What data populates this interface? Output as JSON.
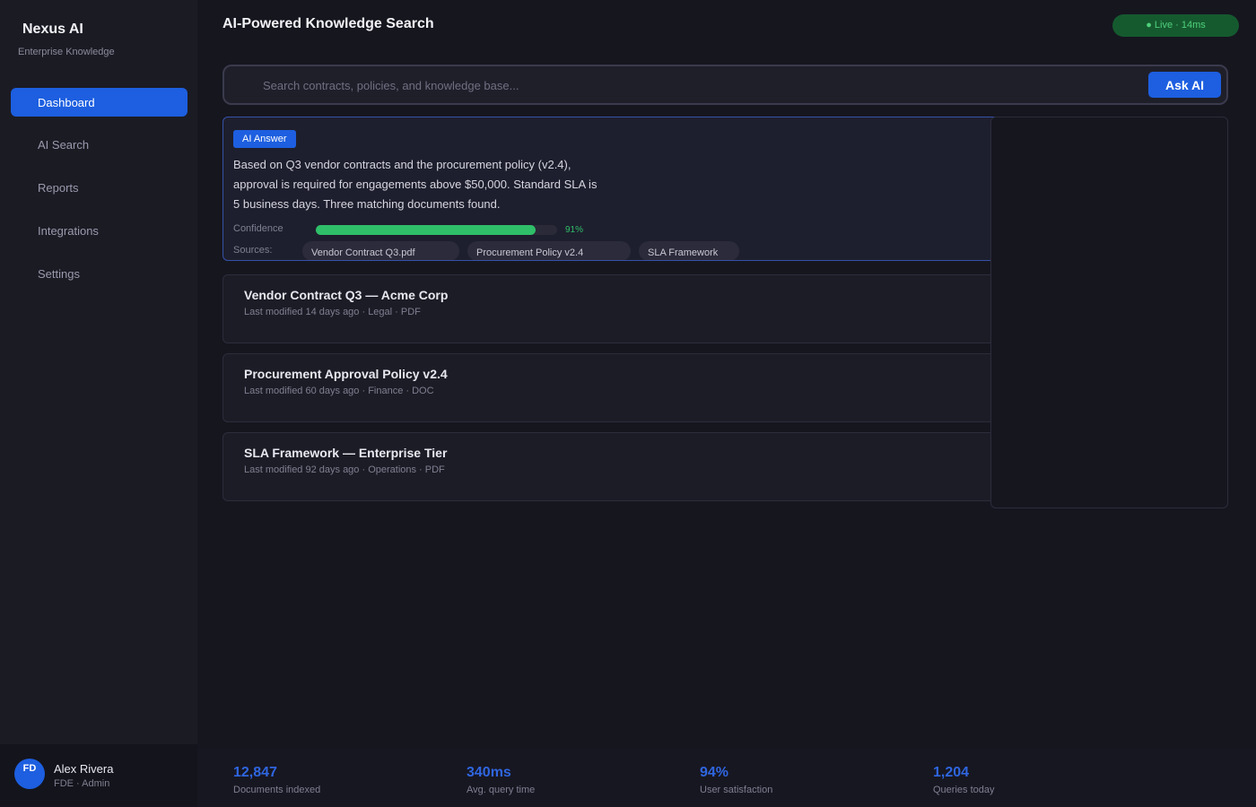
{
  "brand": {
    "icon": "brain-icon",
    "glyph": "",
    "name": "Nexus AI",
    "subtitle": "Enterprise Knowledge"
  },
  "sidebar": {
    "items": [
      {
        "label": "Dashboard",
        "icon": "dashboard-icon",
        "glyph": "",
        "active": true
      },
      {
        "label": "AI Search",
        "icon": "search-icon",
        "glyph": ""
      },
      {
        "label": "Reports",
        "icon": "reports-icon",
        "glyph": ""
      },
      {
        "label": "Integrations",
        "icon": "integrations-icon",
        "glyph": ""
      },
      {
        "label": "Settings",
        "icon": "gear-icon",
        "glyph": ""
      }
    ]
  },
  "user": {
    "initials": "FD",
    "name": "Alex Rivera",
    "role": "FDE · Admin"
  },
  "header": {
    "title": "AI-Powered Knowledge Search",
    "status": "● Live · 14ms"
  },
  "search": {
    "icon_glyph": "",
    "placeholder": "Search contracts, policies, and knowledge base...",
    "value": "",
    "button_label": "Ask AI"
  },
  "answer": {
    "badge": "AI Answer",
    "text": "Based on Q3 vendor contracts and the procurement policy (v2.4), approval is required for engagements above $50,000. Standard SLA is 5 business days. Three matching documents found.",
    "confidence_label": "Confidence",
    "confidence_value": "91%",
    "confidence": 0.91,
    "sources_label": "Sources:",
    "sources": [
      "Vendor Contract Q3.pdf",
      "Procurement Policy v2.4",
      "SLA Framework"
    ]
  },
  "results": [
    {
      "title": "Vendor Contract Q3 — Acme Corp",
      "meta": "Last modified 14 days ago · Legal · PDF"
    },
    {
      "title": "Procurement Approval Policy v2.4",
      "meta": "Last modified 60 days ago · Finance · DOC"
    },
    {
      "title": "SLA Framework — Enterprise Tier",
      "meta": "Last modified 92 days ago · Operations · PDF"
    }
  ],
  "stats": [
    {
      "value": "12,847",
      "label": "Documents indexed"
    },
    {
      "value": "340ms",
      "label": "Avg. query time"
    },
    {
      "value": "94%",
      "label": "User satisfaction"
    },
    {
      "value": "1,204",
      "label": "Queries today"
    }
  ],
  "colors": {
    "accent": "#1d5fe0",
    "success": "#2fbf69",
    "live_bg": "#155a2f",
    "background": "#16161f"
  }
}
